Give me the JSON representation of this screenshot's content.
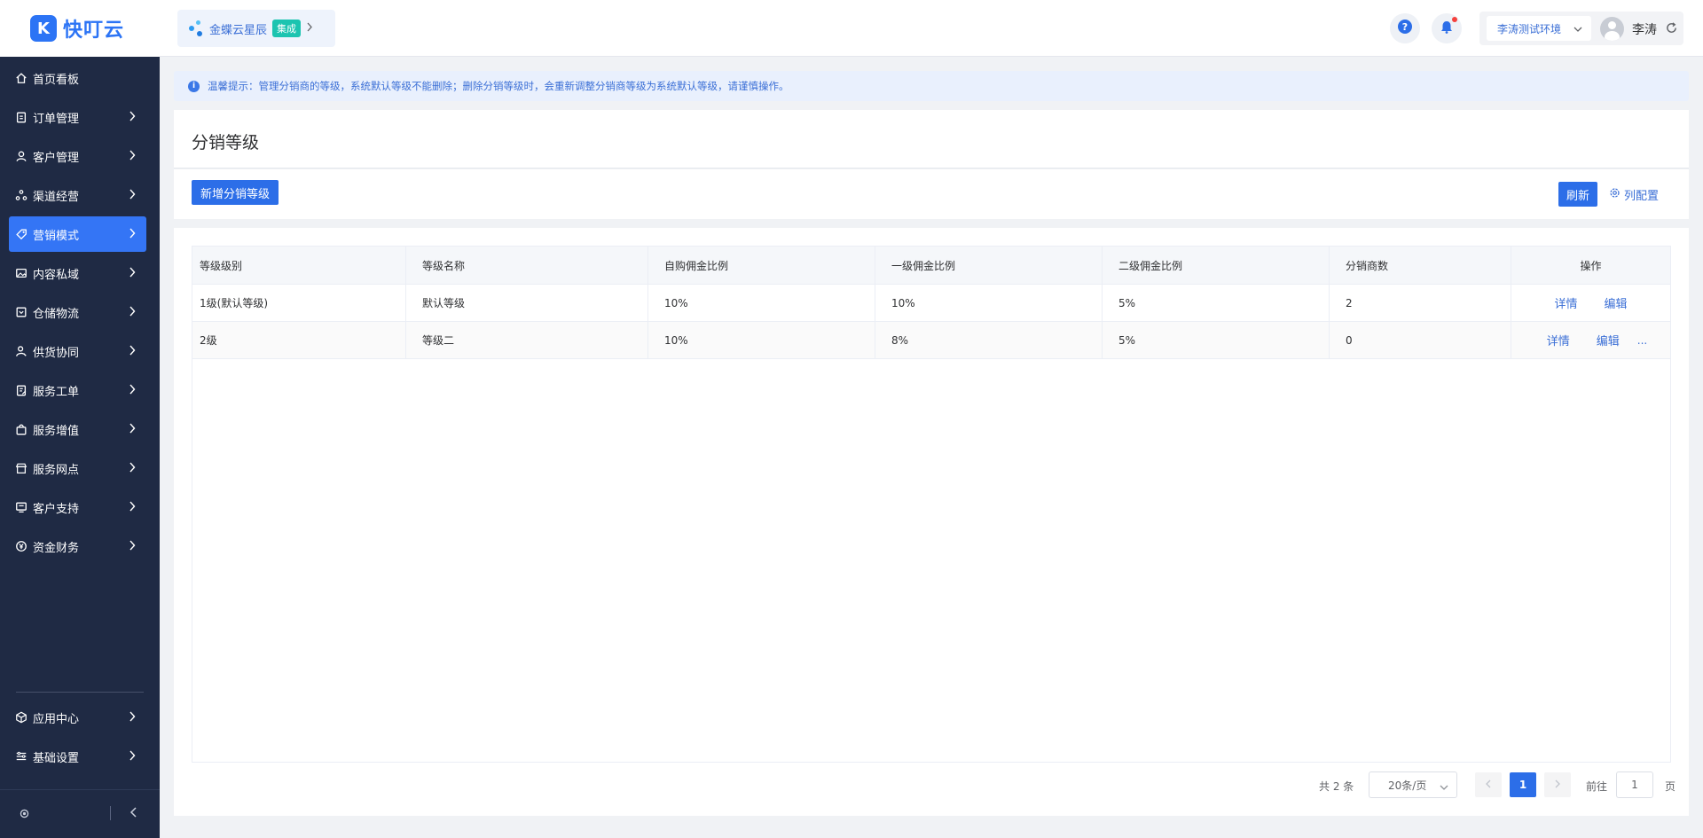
{
  "app": {
    "logo_text": "快叮云",
    "logo_mark": "K"
  },
  "sidebar": {
    "items": [
      {
        "label": "首页看板",
        "icon": "home-icon",
        "has_children": false,
        "active": false
      },
      {
        "label": "订单管理",
        "icon": "clipboard-icon",
        "has_children": true,
        "active": false
      },
      {
        "label": "客户管理",
        "icon": "user-icon",
        "has_children": true,
        "active": false
      },
      {
        "label": "渠道经营",
        "icon": "channel-icon",
        "has_children": true,
        "active": false
      },
      {
        "label": "营销模式",
        "icon": "tag-icon",
        "has_children": true,
        "active": true
      },
      {
        "label": "内容私域",
        "icon": "image-icon",
        "has_children": true,
        "active": false
      },
      {
        "label": "仓储物流",
        "icon": "warehouse-icon",
        "has_children": true,
        "active": false
      },
      {
        "label": "供货协同",
        "icon": "supplier-icon",
        "has_children": true,
        "active": false
      },
      {
        "label": "服务工单",
        "icon": "ticket-icon",
        "has_children": true,
        "active": false
      },
      {
        "label": "服务增值",
        "icon": "bag-icon",
        "has_children": true,
        "active": false
      },
      {
        "label": "服务网点",
        "icon": "store-icon",
        "has_children": true,
        "active": false
      },
      {
        "label": "客户支持",
        "icon": "support-icon",
        "has_children": true,
        "active": false
      },
      {
        "label": "资金财务",
        "icon": "yuan-icon",
        "has_children": true,
        "active": false
      }
    ],
    "bottom_items": [
      {
        "label": "应用中心",
        "icon": "cube-icon"
      },
      {
        "label": "基础设置",
        "icon": "settings-list-icon"
      }
    ]
  },
  "header": {
    "brand": {
      "name": "金蝶云星辰",
      "tag": "集成"
    },
    "environment": "李涛测试环境",
    "user_name": "李涛"
  },
  "notice": {
    "text": "温馨提示：管理分销商的等级，系统默认等级不能删除；删除分销等级时，会重新调整分销商等级为系统默认等级，请谨慎操作。"
  },
  "page": {
    "title": "分销等级",
    "add_button": "新增分销等级",
    "refresh_button": "刷新",
    "column_config": "列配置"
  },
  "table": {
    "columns": [
      "等级级别",
      "等级名称",
      "自购佣金比例",
      "一级佣金比例",
      "二级佣金比例",
      "分销商数",
      "操作"
    ],
    "rows": [
      {
        "level": "1级(默认等级)",
        "name": "默认等级",
        "self": "10%",
        "first": "10%",
        "second": "5%",
        "count": "2",
        "actions": [
          "详情",
          "编辑"
        ],
        "more": ""
      },
      {
        "level": "2级",
        "name": "等级二",
        "self": "10%",
        "first": "8%",
        "second": "5%",
        "count": "0",
        "actions": [
          "详情",
          "编辑"
        ],
        "more": "..."
      }
    ]
  },
  "pagination": {
    "total": "共 2 条",
    "page_size": "20条/页",
    "current_page": "1",
    "goto_label": "前往",
    "goto_value": "1",
    "goto_suffix": "页"
  },
  "colors": {
    "primary": "#2c6ee8",
    "sidebar_bg": "#1f2a44",
    "active_menu": "#3475f5",
    "notice_bg": "#e9f0fd",
    "brand_tag": "#1cc4b0"
  }
}
